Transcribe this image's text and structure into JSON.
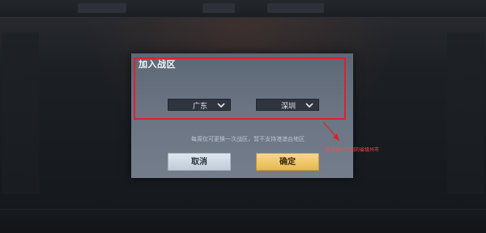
{
  "dialog": {
    "title": "加入战区",
    "province": {
      "selected": "广东",
      "icon": "chevron-down-icon"
    },
    "city": {
      "selected": "深圳",
      "icon": "chevron-down-icon"
    },
    "notice": "每周仅可更换一次战区，暂不支持港澳台地区",
    "cancel_label": "取消",
    "confirm_label": "确定"
  },
  "annotation": {
    "text": "能准确分区到的省级州市",
    "color": "#e0202a"
  }
}
